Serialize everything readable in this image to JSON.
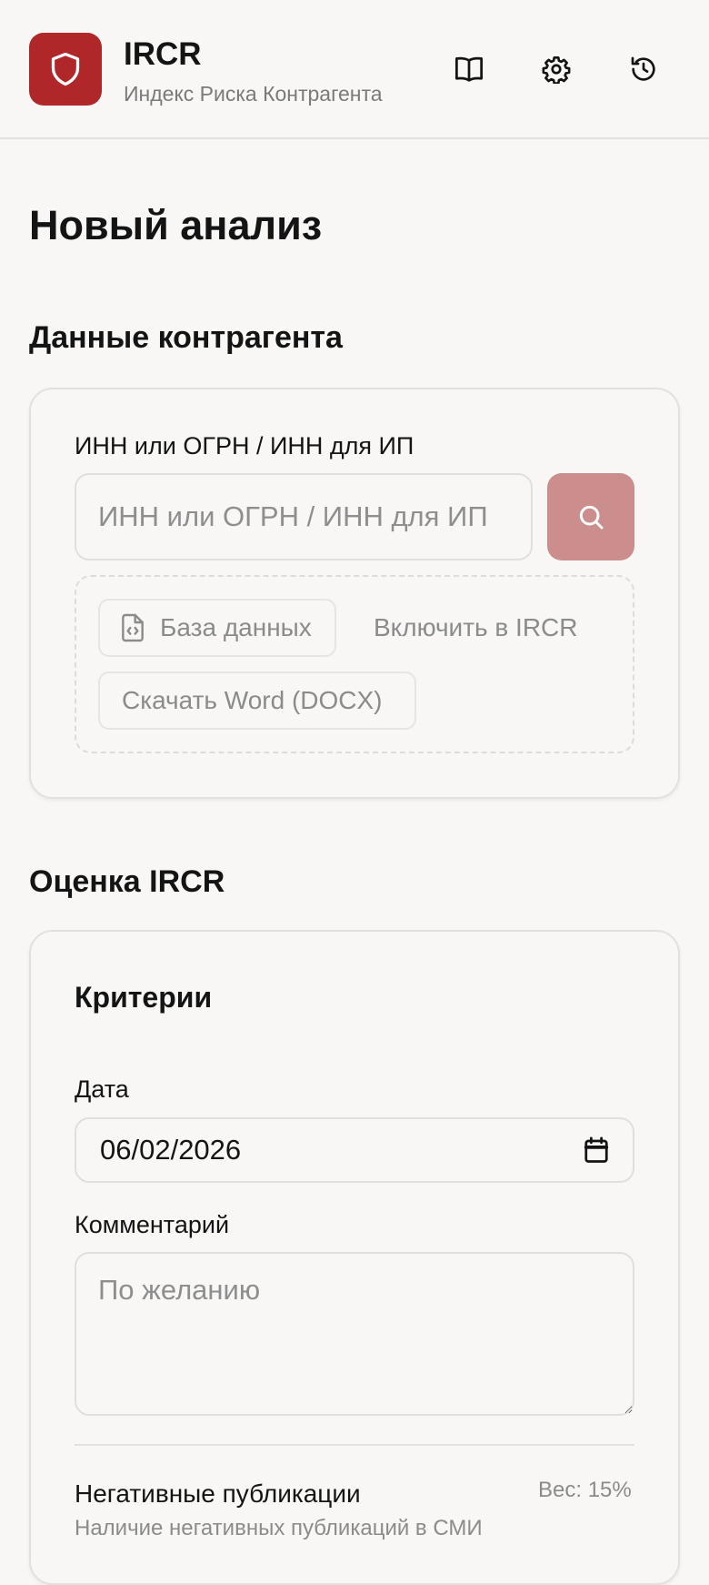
{
  "header": {
    "app_name": "IRCR",
    "app_subtitle": "Индекс Риска Контрагента",
    "icons": [
      "shield-icon",
      "book-icon",
      "gear-icon",
      "history-icon"
    ]
  },
  "page": {
    "title": "Новый анализ"
  },
  "counterparty": {
    "section_title": "Данные контрагента",
    "field_label": "ИНН или ОГРН / ИНН для ИП",
    "field_placeholder": "ИНН или ОГРН / ИНН для ИП",
    "field_value": "",
    "database_label": "База данных",
    "include_label": "Включить в IRCR",
    "download_label": "Скачать Word (DOCX)"
  },
  "assessment": {
    "section_title": "Оценка IRCR",
    "card_title": "Критерии",
    "date_label": "Дата",
    "date_value": "06/02/2026",
    "comment_label": "Комментарий",
    "comment_placeholder": "По желанию",
    "criteria": [
      {
        "name": "Негативные публикации",
        "weight": "Вес: 15%",
        "description": "Наличие негативных публикаций в СМИ"
      }
    ]
  },
  "colors": {
    "accent": "#b0272a",
    "accent_disabled": "#cc8d8d",
    "background": "#f8f7f5"
  }
}
